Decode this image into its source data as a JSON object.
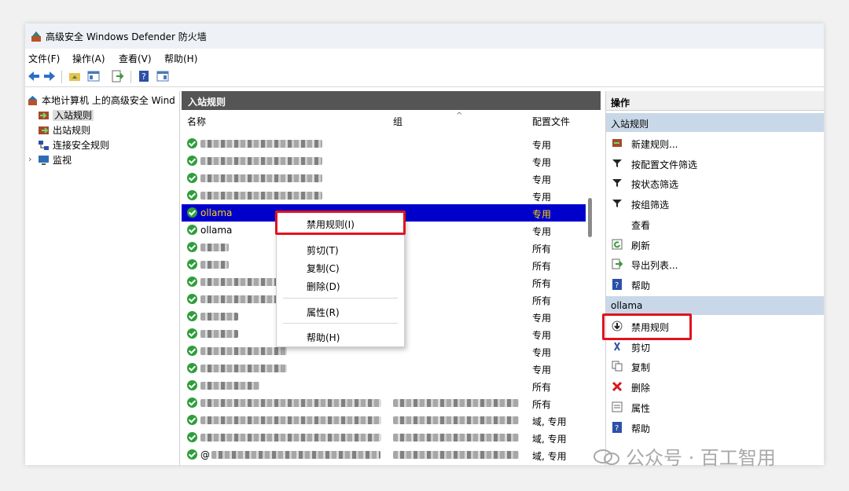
{
  "window": {
    "title": "高级安全 Windows Defender 防火墙"
  },
  "menu": [
    "文件(F)",
    "操作(A)",
    "查看(V)",
    "帮助(H)"
  ],
  "tree": {
    "root": "本地计算机 上的高级安全 Wind",
    "items": [
      "入站规则",
      "出站规则",
      "连接安全规则",
      "监视"
    ]
  },
  "center": {
    "header": "入站规则",
    "columns": {
      "name": "名称",
      "group": "组",
      "profile": "配置文件"
    },
    "rows": [
      {
        "name": "",
        "group": "",
        "profile": "专用"
      },
      {
        "name": "",
        "group": "",
        "profile": "专用"
      },
      {
        "name": "",
        "group": "",
        "profile": "专用"
      },
      {
        "name": "",
        "group": "",
        "profile": "专用"
      },
      {
        "name": "ollama",
        "group": "",
        "profile": "专用"
      },
      {
        "name": "ollama",
        "group": "",
        "profile": "专用"
      },
      {
        "name": "",
        "group": "",
        "profile": "所有"
      },
      {
        "name": "",
        "group": "",
        "profile": "所有"
      },
      {
        "name": "",
        "group": "",
        "profile": "所有"
      },
      {
        "name": "",
        "group": "",
        "profile": "所有"
      },
      {
        "name": "",
        "group": "",
        "profile": "专用"
      },
      {
        "name": "",
        "group": "",
        "profile": "专用"
      },
      {
        "name": "",
        "group": "",
        "profile": "专用"
      },
      {
        "name": "",
        "group": "",
        "profile": "专用"
      },
      {
        "name": "",
        "group": "",
        "profile": "所有"
      },
      {
        "name": "",
        "group": "",
        "profile": "所有"
      },
      {
        "name": "",
        "group": "",
        "profile": "域, 专用"
      },
      {
        "name": "",
        "group": "",
        "profile": "域, 专用"
      },
      {
        "name": "@",
        "group": "",
        "profile": "域, 专用"
      }
    ]
  },
  "context_menu": {
    "disable": "禁用规则(I)",
    "cut": "剪切(T)",
    "copy": "复制(C)",
    "delete": "删除(D)",
    "properties": "属性(R)",
    "help": "帮助(H)"
  },
  "actions": {
    "title": "操作",
    "section1": "入站规则",
    "items1": [
      "新建规则...",
      "按配置文件筛选",
      "按状态筛选",
      "按组筛选",
      "查看",
      "刷新",
      "导出列表...",
      "帮助"
    ],
    "section2": "ollama",
    "items2": [
      "禁用规则",
      "剪切",
      "复制",
      "删除",
      "属性",
      "帮助"
    ]
  },
  "watermark": "公众号 · 百工智用",
  "colors": {
    "selected_row": "#0000cc",
    "highlight_box": "#e0141e",
    "section_bg": "#c9d8e8"
  }
}
